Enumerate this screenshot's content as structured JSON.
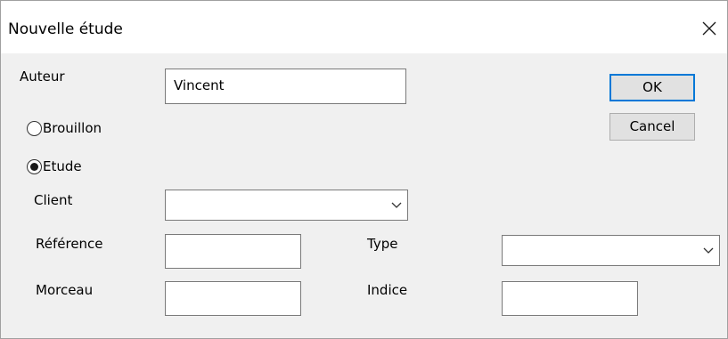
{
  "window": {
    "title": "Nouvelle étude"
  },
  "form": {
    "auteur_label": "Auteur",
    "auteur_value": "Vincent",
    "brouillon_label": "Brouillon",
    "brouillon_selected": false,
    "etude_label": "Etude",
    "etude_selected": true,
    "client_label": "Client",
    "client_value": "",
    "reference_label": "Référence",
    "reference_value": "",
    "morceau_label": "Morceau",
    "morceau_value": "",
    "type_label": "Type",
    "type_value": "",
    "indice_label": "Indice",
    "indice_value": ""
  },
  "buttons": {
    "ok_label": "OK",
    "cancel_label": "Cancel"
  },
  "icons": {
    "close": "close-icon",
    "dropdown": "chevron-down-icon"
  },
  "colors": {
    "dialog_background": "#f0f0f0",
    "titlebar_background": "#ffffff",
    "default_button_border": "#0078d7",
    "button_background": "#e1e1e1"
  }
}
